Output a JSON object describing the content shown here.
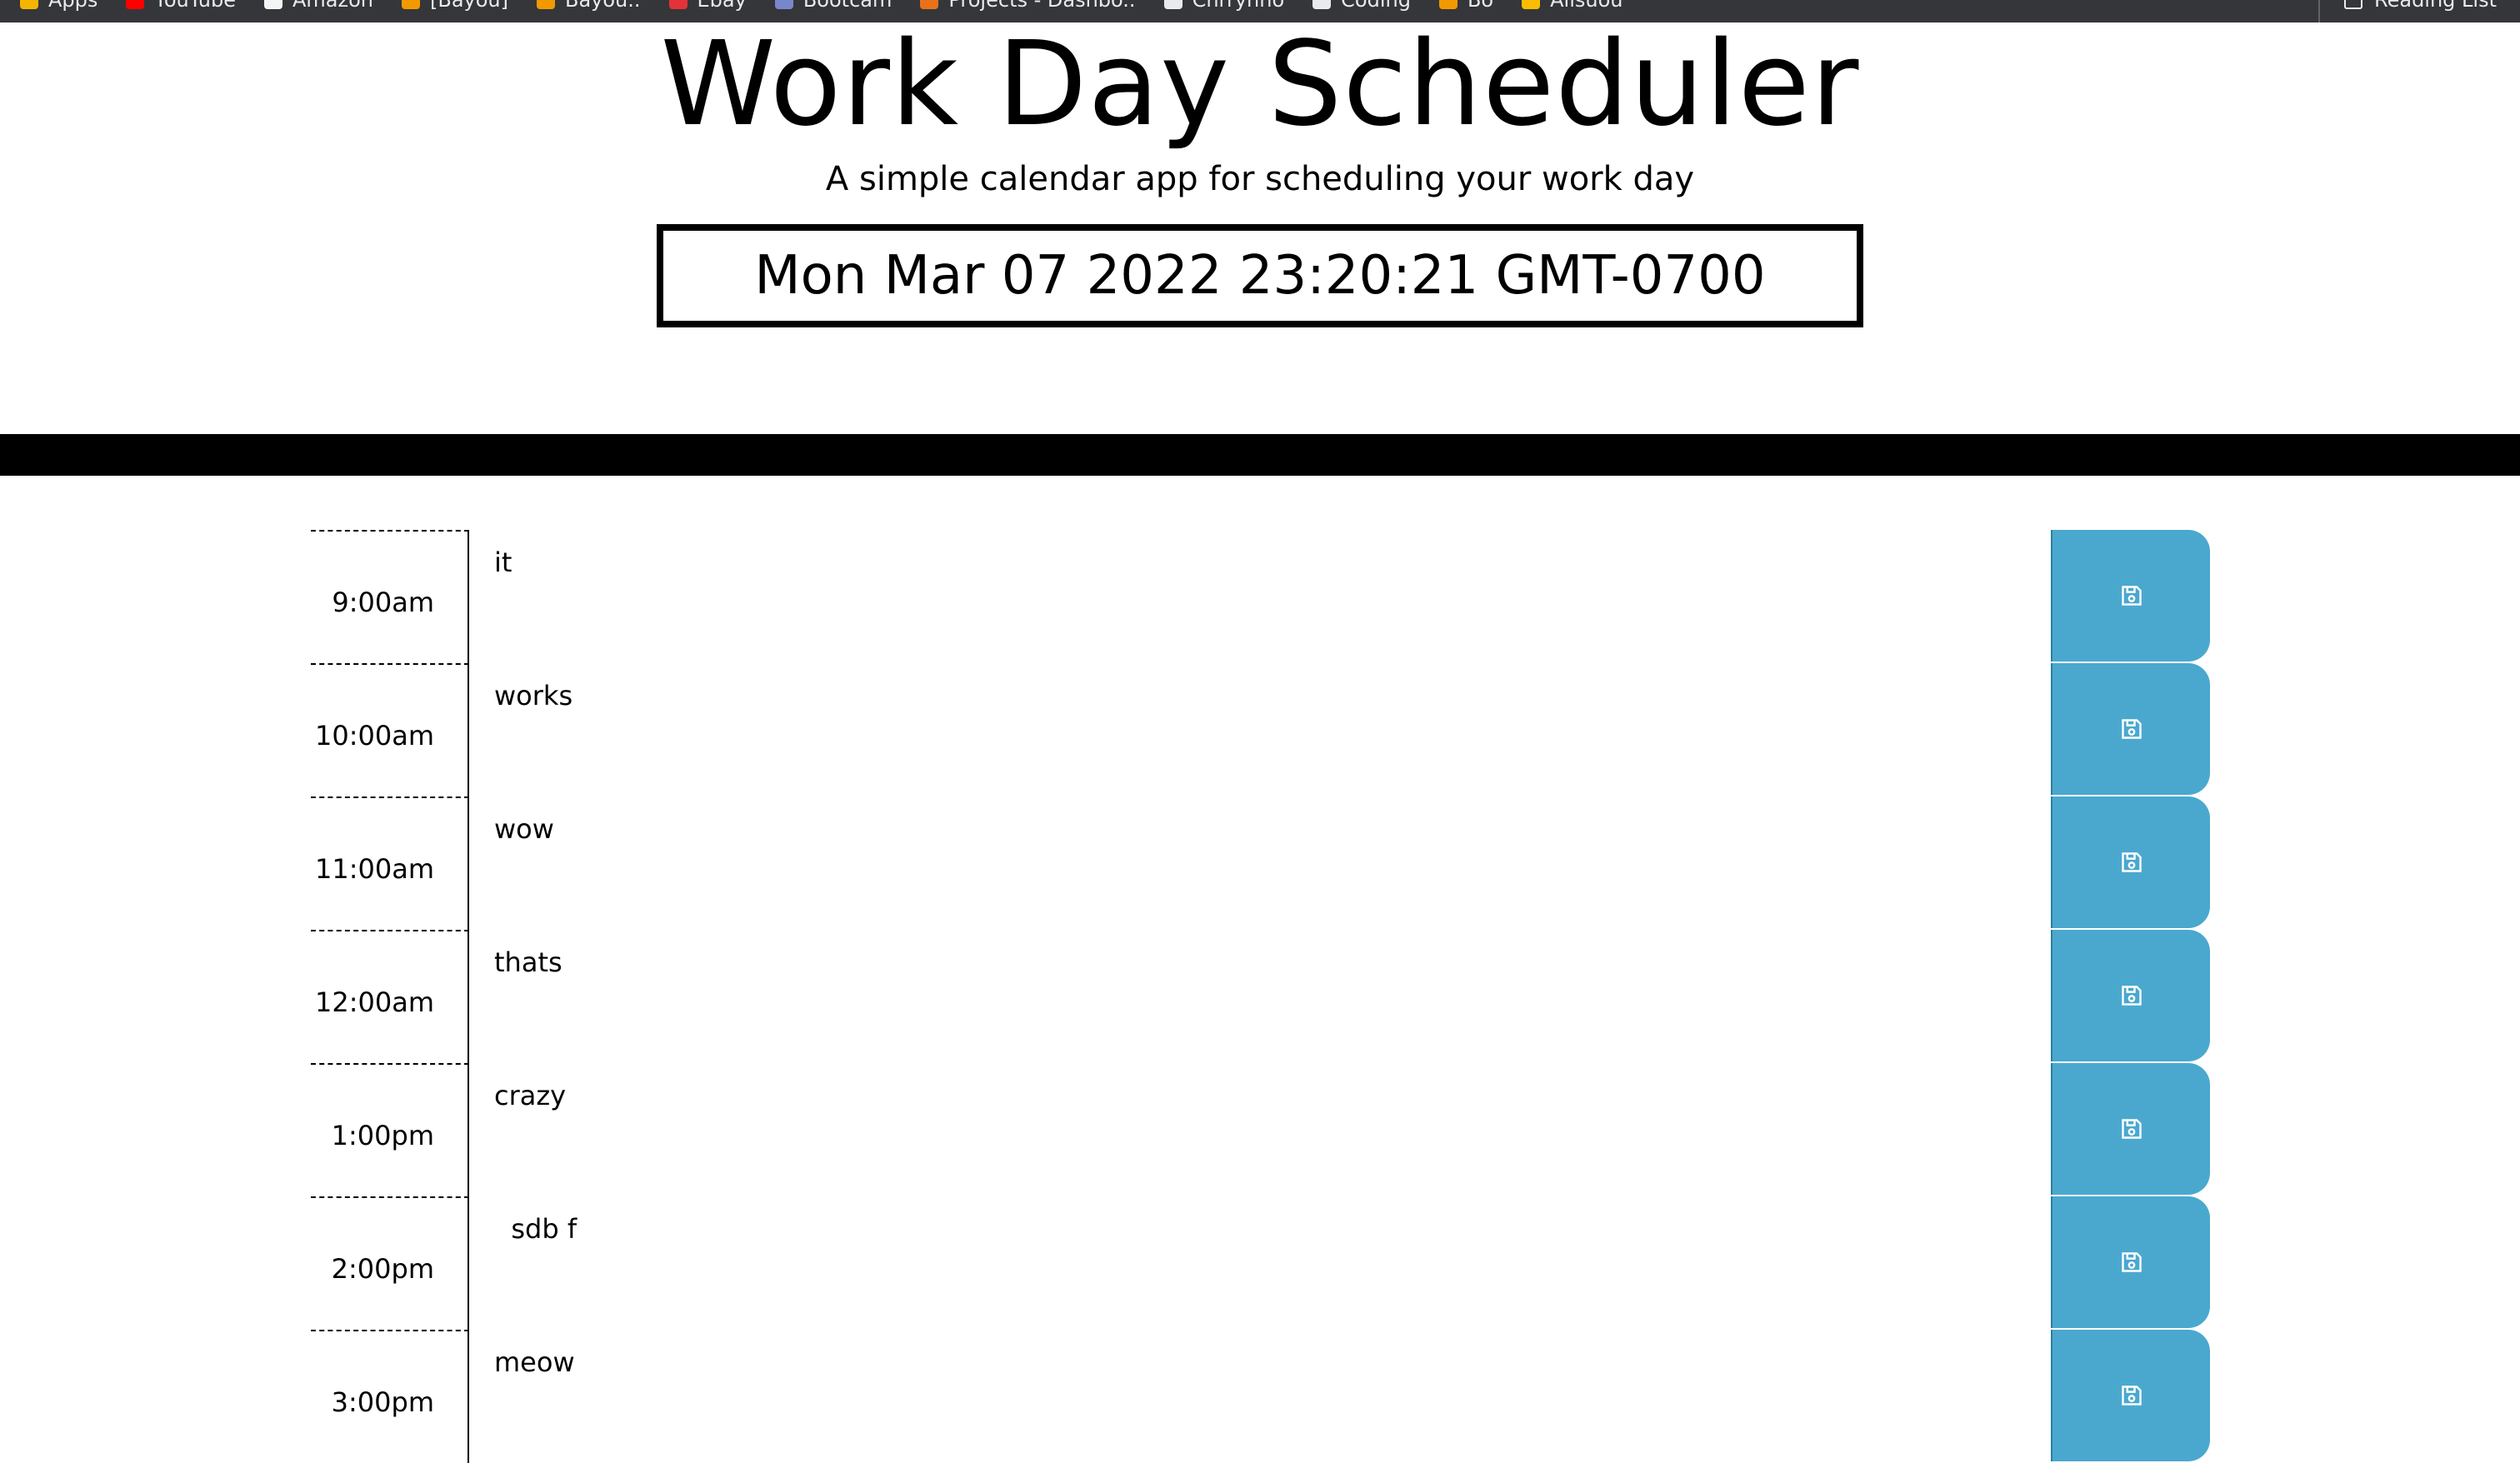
{
  "bookmarks": [
    {
      "label": "Apps",
      "color": "#f4b400"
    },
    {
      "label": "YouTube",
      "color": "#ff0000"
    },
    {
      "label": "Amazon",
      "color": "#f5f5f5"
    },
    {
      "label": "[Bayou]",
      "color": "#f29900"
    },
    {
      "label": "Bayou..",
      "color": "#f29900"
    },
    {
      "label": "Ebay",
      "color": "#e53238"
    },
    {
      "label": "Bootcam",
      "color": "#7986cb"
    },
    {
      "label": "Projects - Dashbo..",
      "color": "#e8711a"
    },
    {
      "label": "Chrrynho",
      "color": "#e8eaed"
    },
    {
      "label": "Coding",
      "color": "#e8eaed"
    },
    {
      "label": "Bo",
      "color": "#f29900"
    },
    {
      "label": "Allsuou",
      "color": "#fbbc04"
    }
  ],
  "reading_list": {
    "label": "Reading List"
  },
  "header": {
    "title": "Work Day Scheduler",
    "subtitle": "A simple calendar app for scheduling your work day",
    "current_datetime": "Mon Mar 07 2022 23:20:21 GMT-0700"
  },
  "rows": [
    {
      "hour": "9:00am",
      "task": "it"
    },
    {
      "hour": "10:00am",
      "task": "works"
    },
    {
      "hour": "11:00am",
      "task": "wow"
    },
    {
      "hour": "12:00am",
      "task": "thats"
    },
    {
      "hour": "1:00pm",
      "task": "crazy"
    },
    {
      "hour": "2:00pm",
      "task": "  sdb f"
    },
    {
      "hour": "3:00pm",
      "task": "meow"
    }
  ],
  "colors": {
    "save_button": "#4aa8cf",
    "divider": "#000000",
    "bookmarks_bar": "#35363a"
  },
  "icons": {
    "save": "floppy-disk-icon"
  }
}
